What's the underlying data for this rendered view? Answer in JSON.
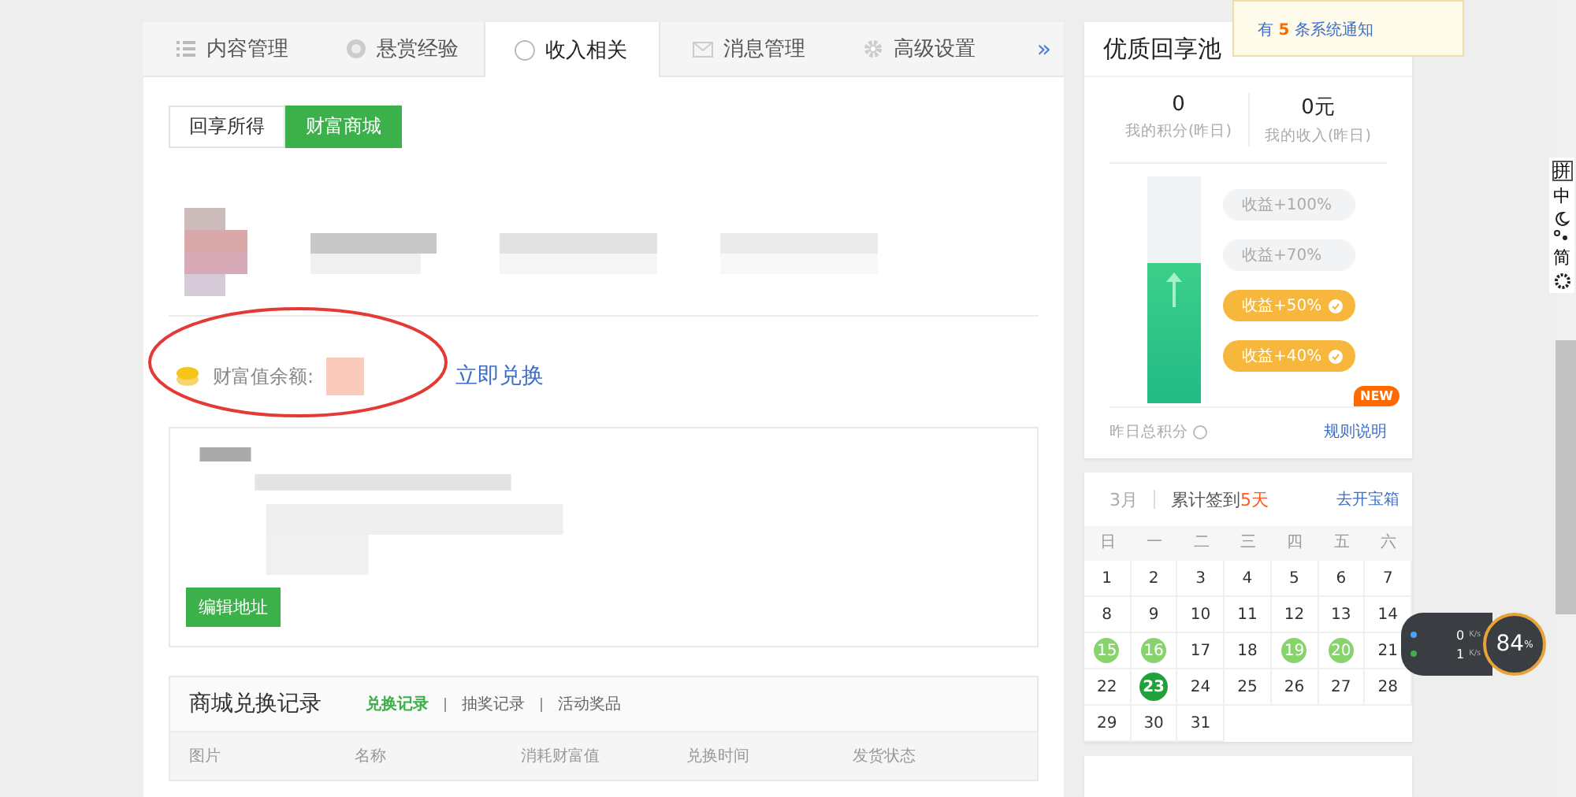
{
  "tabs": [
    {
      "label": "内容管理",
      "selected": false
    },
    {
      "label": "悬赏经验",
      "selected": false
    },
    {
      "label": "收入相关",
      "selected": true
    },
    {
      "label": "消息管理",
      "selected": false
    },
    {
      "label": "高级设置",
      "selected": false
    }
  ],
  "tabs_more": "»",
  "sub_tabs": [
    {
      "label": "回享所得",
      "selected": false
    },
    {
      "label": "财富商城",
      "selected": true
    }
  ],
  "wealth": {
    "label": "财富值余额:",
    "action": "立即兑换"
  },
  "address": {
    "edit_button": "编辑地址"
  },
  "records": {
    "title": "商城兑换记录",
    "filters": [
      {
        "label": "兑换记录",
        "selected": true
      },
      {
        "label": "抽奖记录",
        "selected": false
      },
      {
        "label": "活动奖品",
        "selected": false
      }
    ],
    "columns": [
      "图片",
      "名称",
      "消耗财富值",
      "兑换时间",
      "发货状态"
    ]
  },
  "pool": {
    "title": "优质回享池",
    "stats": [
      {
        "value": "0",
        "label": "我的积分(昨日)"
      },
      {
        "value": "0元",
        "label": "我的收入(昨日)"
      }
    ],
    "level": 0.62,
    "tiers": [
      {
        "label": "收益+100%",
        "reached": false
      },
      {
        "label": "收益+70%",
        "reached": false
      },
      {
        "label": "收益+50%",
        "reached": true
      },
      {
        "label": "收益+40%",
        "reached": true
      }
    ],
    "footer_label": "昨日总积分",
    "rules_link": "规则说明",
    "new_badge": "NEW"
  },
  "notification": {
    "text": "有 **5** 条系统通知"
  },
  "calendar": {
    "month": "3月",
    "summary_prefix": "累计签到",
    "summary_days": "5天",
    "link": "去开宝箱",
    "weekdays": [
      "日",
      "一",
      "二",
      "三",
      "四",
      "五",
      "六"
    ],
    "days": [
      {
        "day": "1",
        "signed": false,
        "today": false
      },
      {
        "day": "2",
        "signed": false,
        "today": false
      },
      {
        "day": "3",
        "signed": false,
        "today": false
      },
      {
        "day": "4",
        "signed": false,
        "today": false
      },
      {
        "day": "5",
        "signed": false,
        "today": false
      },
      {
        "day": "6",
        "signed": false,
        "today": false
      },
      {
        "day": "7",
        "signed": false,
        "today": false
      },
      {
        "day": "8",
        "signed": false,
        "today": false
      },
      {
        "day": "9",
        "signed": false,
        "today": false
      },
      {
        "day": "10",
        "signed": false,
        "today": false
      },
      {
        "day": "11",
        "signed": false,
        "today": false
      },
      {
        "day": "12",
        "signed": false,
        "today": false
      },
      {
        "day": "13",
        "signed": false,
        "today": false
      },
      {
        "day": "14",
        "signed": false,
        "today": false
      },
      {
        "day": "15",
        "signed": true,
        "today": false
      },
      {
        "day": "16",
        "signed": true,
        "today": false
      },
      {
        "day": "17",
        "signed": false,
        "today": false
      },
      {
        "day": "18",
        "signed": false,
        "today": false
      },
      {
        "day": "19",
        "signed": true,
        "today": false
      },
      {
        "day": "20",
        "signed": true,
        "today": false
      },
      {
        "day": "21",
        "signed": false,
        "today": false
      },
      {
        "day": "22",
        "signed": false,
        "today": false
      },
      {
        "day": "23",
        "signed": true,
        "today": true
      },
      {
        "day": "24",
        "signed": false,
        "today": false
      },
      {
        "day": "25",
        "signed": false,
        "today": false
      },
      {
        "day": "26",
        "signed": false,
        "today": false
      },
      {
        "day": "27",
        "signed": false,
        "today": false
      },
      {
        "day": "28",
        "signed": false,
        "today": false
      },
      {
        "day": "29",
        "signed": false,
        "today": false
      },
      {
        "day": "30",
        "signed": false,
        "today": false
      },
      {
        "day": "31",
        "signed": false,
        "today": false
      }
    ]
  },
  "ime_toolbar": {
    "items": [
      "拼",
      "中",
      "简"
    ]
  },
  "speed_widget": {
    "upload": "0",
    "upload_unit": "K/s",
    "download": "1",
    "download_unit": "K/s",
    "percent": "84",
    "percent_unit": "%"
  }
}
